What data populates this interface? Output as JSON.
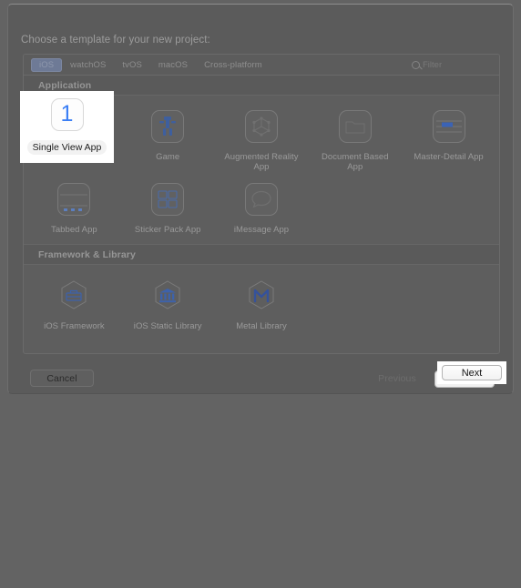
{
  "dialog": {
    "prompt": "Choose a template for your new project:",
    "tabs": [
      {
        "label": "iOS",
        "selected": true
      },
      {
        "label": "watchOS",
        "selected": false
      },
      {
        "label": "tvOS",
        "selected": false
      },
      {
        "label": "macOS",
        "selected": false
      },
      {
        "label": "Cross-platform",
        "selected": false
      }
    ],
    "filter": {
      "placeholder": "Filter",
      "value": "",
      "icon": "search-icon"
    },
    "sections": [
      {
        "title": "Application",
        "items": [
          {
            "label": "Single View App",
            "icon": "single-view-app-icon",
            "selected": true
          },
          {
            "label": "Game",
            "icon": "game-icon",
            "selected": false
          },
          {
            "label": "Augmented Reality App",
            "icon": "augmented-reality-app-icon",
            "selected": false
          },
          {
            "label": "Document Based App",
            "icon": "document-based-app-icon",
            "selected": false
          },
          {
            "label": "Master-Detail App",
            "icon": "master-detail-app-icon",
            "selected": false
          },
          {
            "label": "Tabbed App",
            "icon": "tabbed-app-icon",
            "selected": false
          },
          {
            "label": "Sticker Pack App",
            "icon": "sticker-pack-app-icon",
            "selected": false
          },
          {
            "label": "iMessage App",
            "icon": "imessage-app-icon",
            "selected": false
          }
        ]
      },
      {
        "title": "Framework & Library",
        "items": [
          {
            "label": "iOS Framework",
            "icon": "ios-framework-icon",
            "selected": false
          },
          {
            "label": "iOS Static Library",
            "icon": "ios-static-library-icon",
            "selected": false
          },
          {
            "label": "Metal Library",
            "icon": "metal-library-icon",
            "selected": false
          }
        ]
      }
    ],
    "buttons": {
      "cancel": "Cancel",
      "previous": "Previous",
      "next": "Next"
    },
    "highlights": {
      "template_label": "Single View App",
      "template_badge": "1",
      "next_label": "Next"
    },
    "colors": {
      "accent_blue": "#3b7ff5",
      "tab_selected": "#6e7a96",
      "dialog_bg": "#5b5b5b",
      "desktop_bg": "#636363",
      "highlight_white": "#ffffff"
    }
  }
}
